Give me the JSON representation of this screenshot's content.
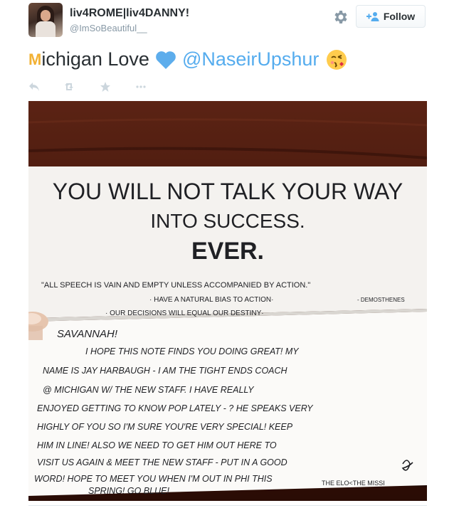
{
  "user": {
    "display_name": "liv4ROME|liv4DANNY!",
    "handle": "@ImSoBeautiful__"
  },
  "follow_button": {
    "label": "Follow"
  },
  "tweet": {
    "logo_text": "M",
    "text_after_logo": "ichigan Love",
    "mention": "@NaseirUpshur"
  },
  "actions": [
    "reply-icon",
    "retweet-icon",
    "favorite-icon",
    "more-icon"
  ],
  "photo": {
    "note_line1": "YOU WILL NOT TALK YOUR WAY",
    "note_line2": "INTO SUCCESS.",
    "note_line3": "EVER.",
    "quote": "\"ALL SPEECH IS VAIN AND EMPTY UNLESS ACCOMPANIED BY ACTION.\"",
    "quote_attrib": "- DEMOSTHENES",
    "bullet1": "· HAVE A NATURAL BIAS TO ACTION·",
    "bullet2": "· OUR DECISIONS WILL EQUAL OUR DESTINY·",
    "greeting": "SAVANNAH!",
    "body_lines": [
      "I HOPE THIS NOTE FINDS YOU DOING GREAT! MY",
      "NAME IS JAY HARBAUGH - I AM THE TIGHT ENDS COACH",
      "@ MICHIGAN W/ THE NEW STAFF. I HAVE REALLY",
      "ENJOYED GETTING TO KNOW POP LATELY - ? HE SPEAKS VERY",
      "HIGHLY OF YOU SO I'M SURE YOU'RE VERY SPECIAL! KEEP",
      "HIM IN LINE! ALSO WE NEED TO GET HIM OUT HERE TO",
      "VISIT US AGAIN & MEET THE NEW STAFF - PUT IN A GOOD",
      "WORD! HOPE TO MEET YOU WHEN I'M OUT IN PHI THIS",
      "SPRING! GO BLUE!"
    ],
    "signoff": "THE ELO<THE MISSI"
  },
  "colors": {
    "link": "#55acee",
    "maize": "#f2b134",
    "text": "#292f33",
    "muted": "#8899a6"
  }
}
